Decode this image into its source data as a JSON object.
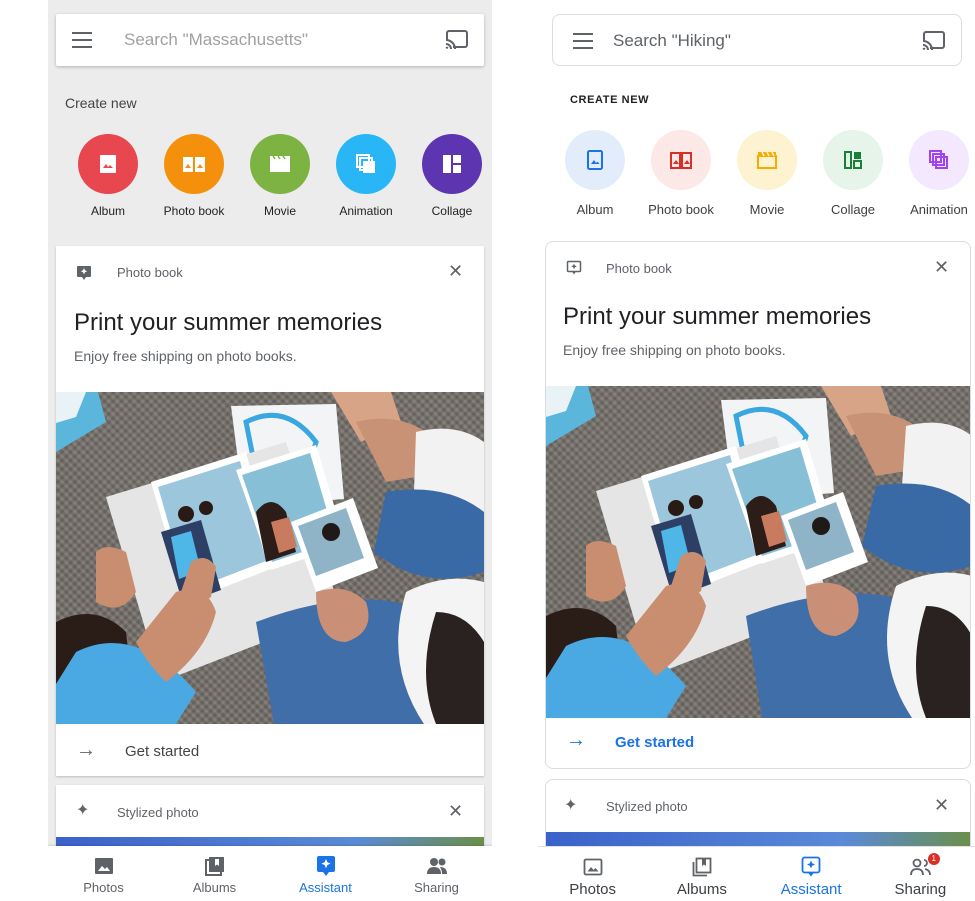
{
  "colors": {
    "blue_accent": "#1a73e8",
    "left_album": "#e8474f",
    "left_photobook": "#f4900c",
    "left_movie": "#7cb342",
    "left_animation": "#29b6f6",
    "left_collage": "#5e35b1"
  },
  "left": {
    "search_placeholder": "Search \"Massachusetts\"",
    "create_new_label": "Create new",
    "create_items": [
      {
        "label": "Album",
        "icon": "album-icon"
      },
      {
        "label": "Photo book",
        "icon": "photo-book-icon"
      },
      {
        "label": "Movie",
        "icon": "movie-icon"
      },
      {
        "label": "Animation",
        "icon": "animation-icon"
      },
      {
        "label": "Collage",
        "icon": "collage-icon"
      }
    ],
    "card": {
      "kind": "Photo book",
      "title": "Print your summer memories",
      "subtitle": "Enjoy free shipping on photo books.",
      "cta": "Get started"
    },
    "card2_kind": "Stylized photo",
    "nav": [
      {
        "label": "Photos",
        "icon": "photos-icon"
      },
      {
        "label": "Albums",
        "icon": "albums-icon"
      },
      {
        "label": "Assistant",
        "icon": "assistant-icon"
      },
      {
        "label": "Sharing",
        "icon": "sharing-icon"
      }
    ]
  },
  "right": {
    "search_placeholder": "Search \"Hiking\"",
    "create_new_label": "CREATE NEW",
    "create_items": [
      {
        "label": "Album",
        "icon": "album-icon"
      },
      {
        "label": "Photo book",
        "icon": "photo-book-icon"
      },
      {
        "label": "Movie",
        "icon": "movie-icon"
      },
      {
        "label": "Collage",
        "icon": "collage-icon"
      },
      {
        "label": "Animation",
        "icon": "animation-icon"
      }
    ],
    "card": {
      "kind": "Photo book",
      "title": "Print your summer memories",
      "subtitle": "Enjoy free shipping on photo books.",
      "cta": "Get started"
    },
    "card2_kind": "Stylized photo",
    "nav": [
      {
        "label": "Photos",
        "icon": "photos-icon"
      },
      {
        "label": "Albums",
        "icon": "albums-icon"
      },
      {
        "label": "Assistant",
        "icon": "assistant-icon"
      },
      {
        "label": "Sharing",
        "icon": "sharing-icon",
        "badge": "1"
      }
    ]
  }
}
